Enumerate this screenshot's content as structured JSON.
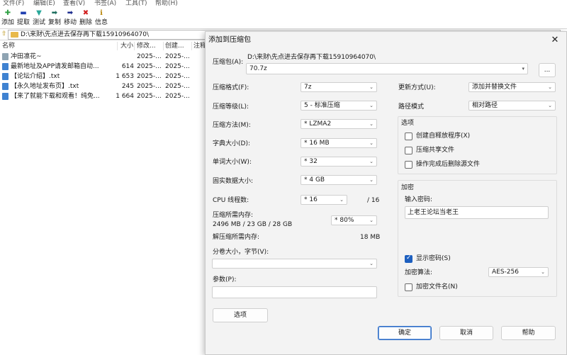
{
  "menu": [
    "文件(F)",
    "编辑(E)",
    "查看(V)",
    "书签(A)",
    "工具(T)",
    "帮助(H)"
  ],
  "toolbar": [
    {
      "label": "添加",
      "icon": "add-icon",
      "glyph": "✚",
      "color": "#2ea043"
    },
    {
      "label": "提取",
      "icon": "extract-icon",
      "glyph": "▬",
      "color": "#1f3fb0"
    },
    {
      "label": "测试",
      "icon": "test-icon",
      "glyph": "▼",
      "color": "#2aa89a"
    },
    {
      "label": "复制",
      "icon": "copy-icon",
      "glyph": "➡",
      "color": "#1f6f5f"
    },
    {
      "label": "移动",
      "icon": "move-icon",
      "glyph": "➡",
      "color": "#1f2f8f"
    },
    {
      "label": "删除",
      "icon": "delete-icon",
      "glyph": "✖",
      "color": "#d11f1f"
    },
    {
      "label": "信息",
      "icon": "info-icon",
      "glyph": "ℹ",
      "color": "#b8860b"
    }
  ],
  "path": "D:\\来财\\先点进去保存再下载15910964070\\",
  "columns": {
    "name": "名称",
    "size": "大小",
    "modified": "修改...",
    "created": "创建...",
    "comment": "注释"
  },
  "files": [
    {
      "name": "冲田凛花~",
      "size": "",
      "modified": "2025-...",
      "created": "2025-...",
      "type": "folder"
    },
    {
      "name": "最新地址及APP请发邮箱自动...",
      "size": "614",
      "modified": "2025-...",
      "created": "2025-...",
      "type": "txt"
    },
    {
      "name": "【论坛介绍】.txt",
      "size": "1 653",
      "modified": "2025-...",
      "created": "2025-...",
      "type": "txt"
    },
    {
      "name": "【永久地址发布页】.txt",
      "size": "245",
      "modified": "2025-...",
      "created": "2025-...",
      "type": "txt"
    },
    {
      "name": "【来了就能下载和观看！纯免...",
      "size": "1 664",
      "modified": "2025-...",
      "created": "2025-...",
      "type": "txt"
    }
  ],
  "dialog": {
    "title": "添加到压缩包",
    "archive_label": "压缩包(A):",
    "archive_path": "D:\\来财\\先点进去保存再下载15910964070\\",
    "archive_name": "70.7z",
    "browse": "...",
    "format_label": "压缩格式(F):",
    "format": "7z",
    "level_label": "压缩等级(L):",
    "level": "5 - 标准压缩",
    "method_label": "压缩方法(M):",
    "method": "*  LZMA2",
    "dict_label": "字典大小(D):",
    "dict": "*  16 MB",
    "word_label": "单词大小(W):",
    "word": "*  32",
    "solid_label": "固实数据大小:",
    "solid": "*  4 GB",
    "cpu_label": "CPU 线程数:",
    "cpu": "*  16",
    "cpu_total": "/ 16",
    "mem_label": "压缩所需内存:",
    "mem_value": "2496 MB / 23 GB / 28 GB",
    "mem_pct": "* 80%",
    "decomp_label": "解压缩所需内存:",
    "decomp_value": "18 MB",
    "split_label": "分卷大小，字节(V):",
    "split": "",
    "params_label": "参数(P):",
    "params": "",
    "options_button": "选项",
    "update_label": "更新方式(U):",
    "update": "添加并替换文件",
    "pathmode_label": "路径模式",
    "pathmode": "相对路径",
    "options_group": "选项",
    "opt_sfx": "创建自释放程序(X)",
    "opt_shared": "压缩共享文件",
    "opt_delete": "操作完成后删除源文件",
    "encrypt_group": "加密",
    "password_label": "输入密码:",
    "password": "上老王论坛当老王",
    "show_password": "显示密码(S)",
    "enc_method_label": "加密算法:",
    "enc_method": "AES-256",
    "enc_names": "加密文件名(N)",
    "ok": "确定",
    "cancel": "取消",
    "help": "帮助"
  }
}
